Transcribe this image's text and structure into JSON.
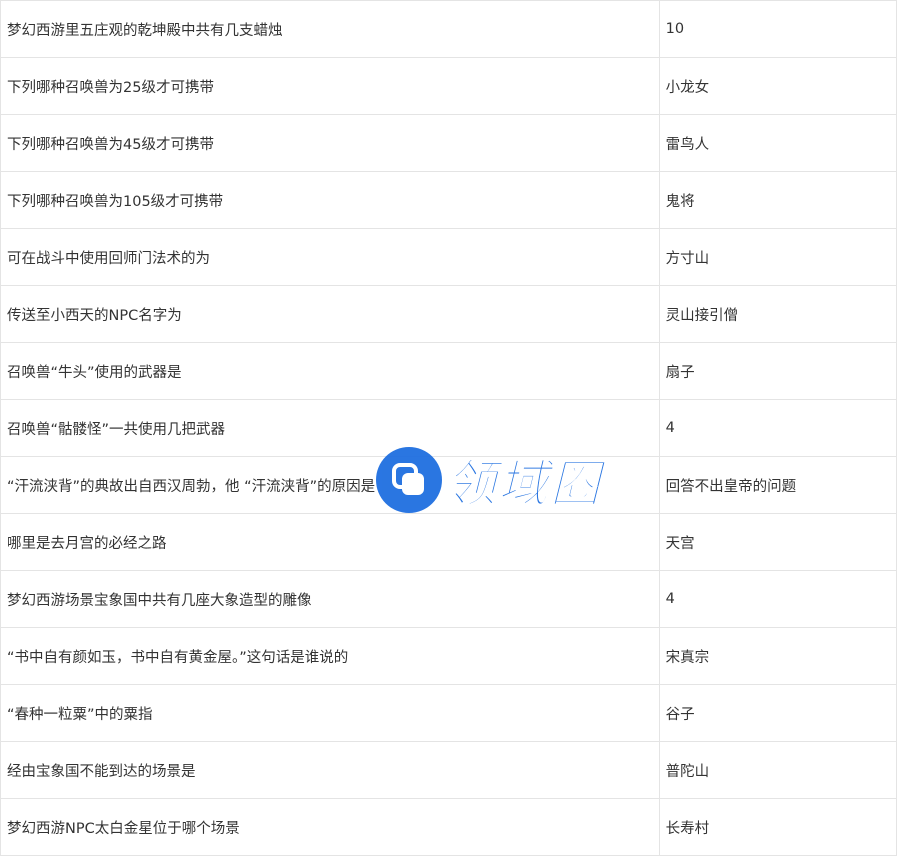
{
  "rows": [
    {
      "question": "梦幻西游里五庄观的乾坤殿中共有几支蜡烛",
      "answer": "10"
    },
    {
      "question": "下列哪种召唤兽为25级才可携带",
      "answer": "小龙女"
    },
    {
      "question": "下列哪种召唤兽为45级才可携带",
      "answer": "雷鸟人"
    },
    {
      "question": "下列哪种召唤兽为105级才可携带",
      "answer": "鬼将"
    },
    {
      "question": "可在战斗中使用回师门法术的为",
      "answer": "方寸山"
    },
    {
      "question": "传送至小西天的NPC名字为",
      "answer": "灵山接引僧"
    },
    {
      "question": "召唤兽“牛头”使用的武器是",
      "answer": "扇子"
    },
    {
      "question": "召唤兽“骷髅怪”一共使用几把武器",
      "answer": "4"
    },
    {
      "question": "“汗流浃背”的典故出自西汉周勃，他 “汗流浃背”的原因是",
      "answer": "回答不出皇帝的问题"
    },
    {
      "question": "哪里是去月宫的必经之路",
      "answer": "天宫"
    },
    {
      "question": "梦幻西游场景宝象国中共有几座大象造型的雕像",
      "answer": "4"
    },
    {
      "question": "“书中自有颜如玉，书中自有黄金屋。”这句话是谁说的",
      "answer": "宋真宗"
    },
    {
      "question": "“春种一粒粟”中的粟指",
      "answer": "谷子"
    },
    {
      "question": "经由宝象国不能到达的场景是",
      "answer": "普陀山"
    },
    {
      "question": "梦幻西游NPC太白金星位于哪个场景",
      "answer": "长寿村"
    }
  ],
  "watermark": {
    "text": "领域圈",
    "color": "#1f6fe0",
    "logo_icon": "chat-bubble-icon"
  }
}
